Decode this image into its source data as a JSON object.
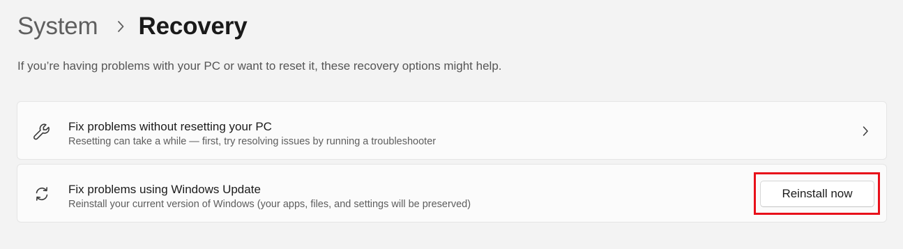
{
  "breadcrumb": {
    "parent": "System",
    "current": "Recovery"
  },
  "description": "If you’re having problems with your PC or want to reset it, these recovery options might help.",
  "cards": [
    {
      "icon": "wrench-icon",
      "title": "Fix problems without resetting your PC",
      "subtitle": "Resetting can take a while — first, try resolving issues by running a troubleshooter"
    },
    {
      "icon": "sync-icon",
      "title": "Fix problems using Windows Update",
      "subtitle": "Reinstall your current version of Windows (your apps, files, and settings will be preserved)",
      "button_label": "Reinstall now"
    }
  ],
  "colors": {
    "highlight": "#e8101a",
    "background": "#f3f3f3",
    "card": "#fbfbfb"
  }
}
